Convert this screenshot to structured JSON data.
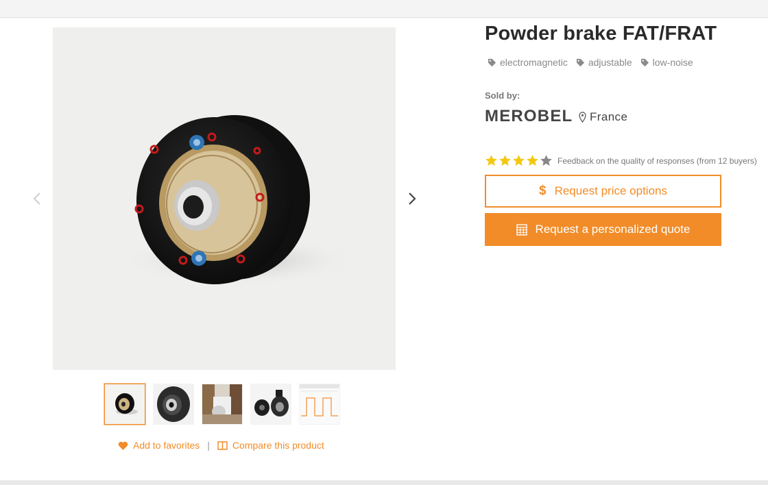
{
  "product": {
    "title_bold": "Powder brake",
    "title_light": "FAT/FRAT",
    "tags": [
      "electromagnetic",
      "adjustable",
      "low-noise"
    ]
  },
  "seller": {
    "sold_by_label": "Sold by:",
    "name": "MEROBEL",
    "country": "France",
    "rating": 4,
    "rating_max": 5,
    "feedback": "Feedback on the quality of responses (from 12 buyers)"
  },
  "buttons": {
    "price_options": "Request price options",
    "personalized_quote": "Request a personalized quote"
  },
  "gallery": {
    "thumbnail_count": 5,
    "active_thumbnail": 1
  },
  "links": {
    "favorites": "Add to favorites",
    "separator": "|",
    "compare": "Compare this product"
  },
  "colors": {
    "accent": "#f28c28",
    "star_filled": "#f3c811",
    "star_empty": "#888888"
  },
  "icons": [
    "chevron-left-icon",
    "chevron-right-icon",
    "tag-icon",
    "map-pin-icon",
    "star-icon",
    "dollar-icon",
    "calculator-icon",
    "heart-icon",
    "compare-icon"
  ]
}
